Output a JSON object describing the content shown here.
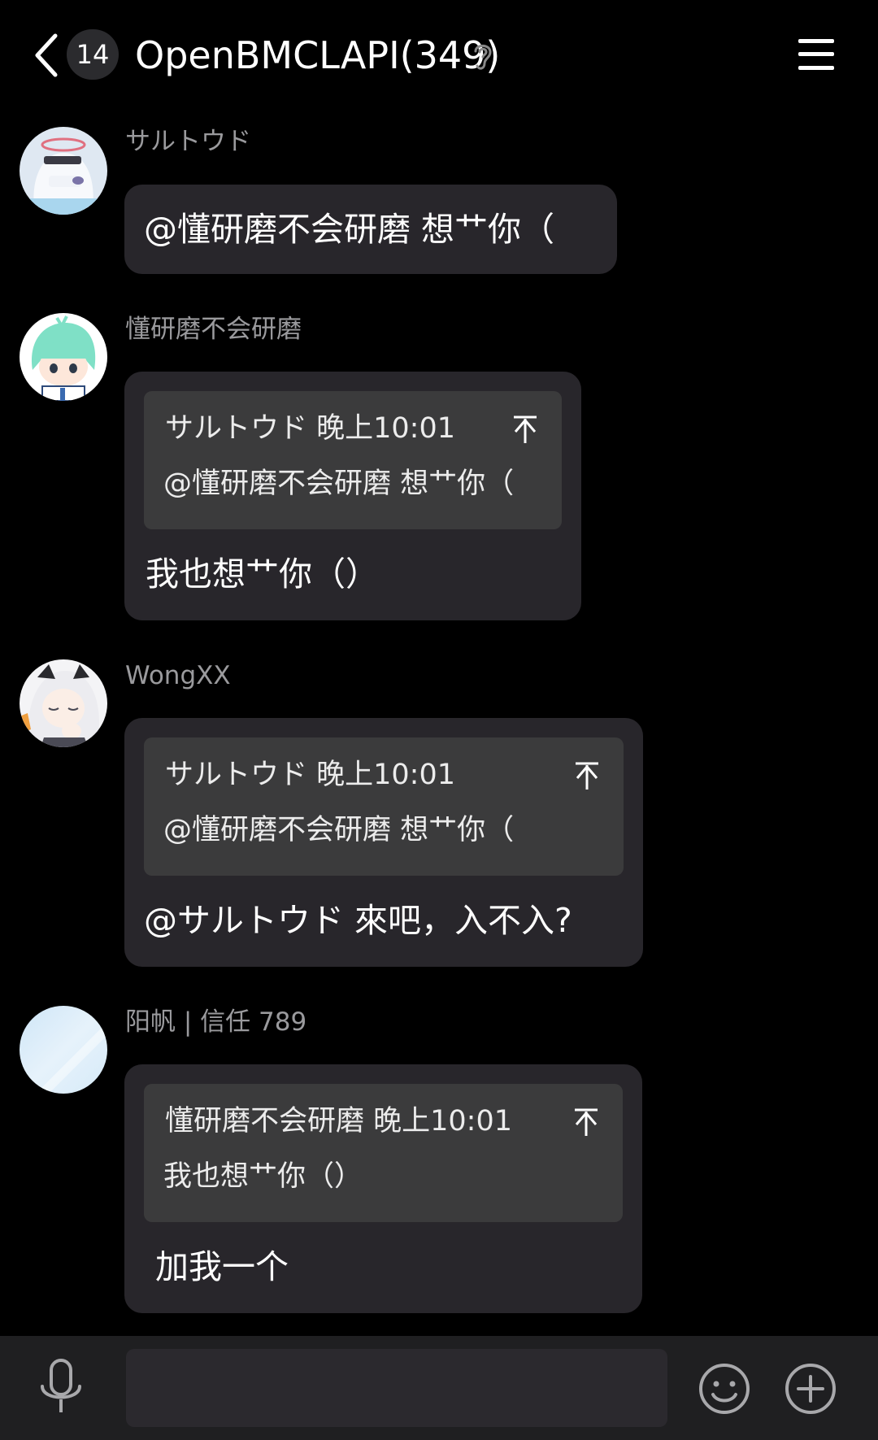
{
  "header": {
    "unread_count": "14",
    "title": "OpenBMCLAPI(349)"
  },
  "messages": [
    {
      "sender": "サルトウド",
      "text": "@懂研磨不会研磨 想艹你（"
    },
    {
      "sender": "懂研磨不会研磨",
      "quote": {
        "author_time": "サルトウド 晚上10:01",
        "text": "@懂研磨不会研磨 想艹你（"
      },
      "text": "我也想艹你（）"
    },
    {
      "sender": "WongXX",
      "quote": {
        "author_time": "サルトウド 晚上10:01",
        "text": "@懂研磨不会研磨 想艹你（"
      },
      "text": "@サルトウド 來吧，入不入?"
    },
    {
      "sender": "阳帆 | 信任 789",
      "quote": {
        "author_time": "懂研磨不会研磨 晚上10:01",
        "text": "我也想艹你（）"
      },
      "text": "加我一个"
    }
  ],
  "input": {
    "placeholder": ""
  },
  "colors": {
    "background": "#000000",
    "bubble": "#28262b",
    "quote": "#3b3b3c",
    "sender_name": "#9a9a9d",
    "input_bar": "#1f1f21"
  }
}
